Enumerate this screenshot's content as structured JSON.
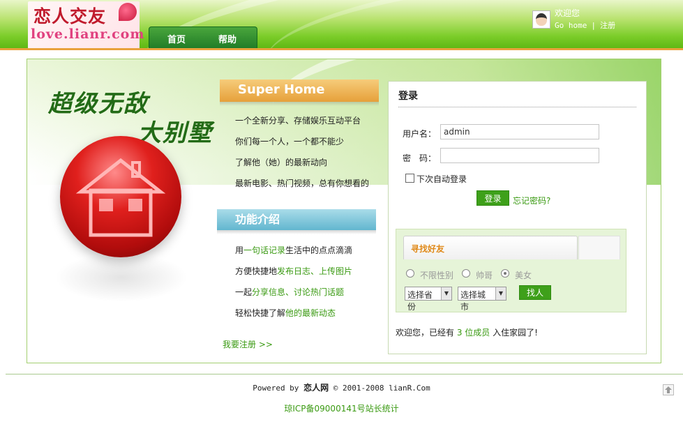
{
  "logo": {
    "cn_text": "恋人交友",
    "en_text": "love.lianr.com"
  },
  "nav": {
    "items": [
      {
        "label": "首页"
      },
      {
        "label": "帮助"
      }
    ]
  },
  "user": {
    "welcome": "欢迎您",
    "go_home": "Go home",
    "separator": "|",
    "register": "注册"
  },
  "hero": {
    "slogan_line1": "超级无敌",
    "slogan_line2": "大别墅",
    "super_banner": "Super Home",
    "desc_lines": [
      "一个全新分享、存储娱乐互动平台",
      "你们每一个人，一个都不能少",
      "了解他（她）的最新动向",
      "最新电影、热门视频，总有你想看的"
    ],
    "func_banner": "功能介绍",
    "features": [
      {
        "pre": "用",
        "link": "一句话记录",
        "post": "生活中的点点滴滴"
      },
      {
        "pre": "方便快捷地",
        "link": "发布日志、上传图片",
        "post": ""
      },
      {
        "pre": "一起",
        "link": "分享信息、讨论热门话题",
        "post": ""
      },
      {
        "pre": "轻松快捷了解",
        "link": "他的最新动态",
        "post": ""
      }
    ],
    "register_link": "我要注册 >>"
  },
  "login": {
    "title": "登录",
    "username_label": "用户名：",
    "username_value": "admin",
    "password_label": "密　码：",
    "password_value": "",
    "auto_login_label": "下次自动登录",
    "login_button": "登录",
    "forgot_link": "忘记密码?"
  },
  "find_friend": {
    "tab_label": "寻找好友",
    "gender_options": [
      {
        "label": "不限性别",
        "selected": false
      },
      {
        "label": "帅哥",
        "selected": false
      },
      {
        "label": "美女",
        "selected": true
      }
    ],
    "province_select": "选择省份",
    "city_select": "选择城市",
    "find_button": "找人"
  },
  "members": {
    "pre": "欢迎您，已经有",
    "count": "3 位成员",
    "post": "入住家园了!"
  },
  "footer": {
    "powered_pre": "Powered by",
    "powered_brand": "恋人网",
    "powered_post": "© 2001-2008 lianR.Com",
    "icp": "琼ICP备09000141号站长统计"
  },
  "colors": {
    "accent_green": "#3ea01a",
    "link_green": "#3a9a12",
    "orange_banner": "#e6a03a",
    "blue_banner": "#62b6cf"
  }
}
